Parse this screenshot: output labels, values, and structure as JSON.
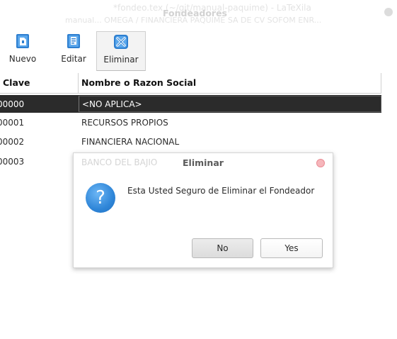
{
  "window": {
    "title": "Fondeadores",
    "background_text_1": "*fondeo.tex (~/git/manual-paquime) - LaTeXila",
    "background_text_2": "manual... OMEGA / FINANCIERA PAQUIME SA DE CV SOFOM ENR..."
  },
  "toolbar": {
    "nuevo_label": "Nuevo",
    "editar_label": "Editar",
    "eliminar_label": "Eliminar"
  },
  "table": {
    "columns": [
      "Clave",
      "Nombre o Razon Social"
    ],
    "rows": [
      {
        "clave": "00000",
        "nombre": "<NO APLICA>",
        "selected": true
      },
      {
        "clave": "00001",
        "nombre": "RECURSOS PROPIOS"
      },
      {
        "clave": "00002",
        "nombre": "FINANCIERA NACIONAL"
      },
      {
        "clave": "00003",
        "nombre": "BANCO DEL BAJIO"
      }
    ]
  },
  "dialog": {
    "title": "Eliminar",
    "behind_text": "BANCO DEL BAJIO",
    "message": "Esta Usted Seguro de Eliminar el Fondeador",
    "icon": "question-icon",
    "no_label": "No",
    "yes_label": "Yes"
  },
  "colors": {
    "selection": "#2b2b2b",
    "question_icon": "#2f86d8",
    "close_button": "#f6b6bb"
  }
}
